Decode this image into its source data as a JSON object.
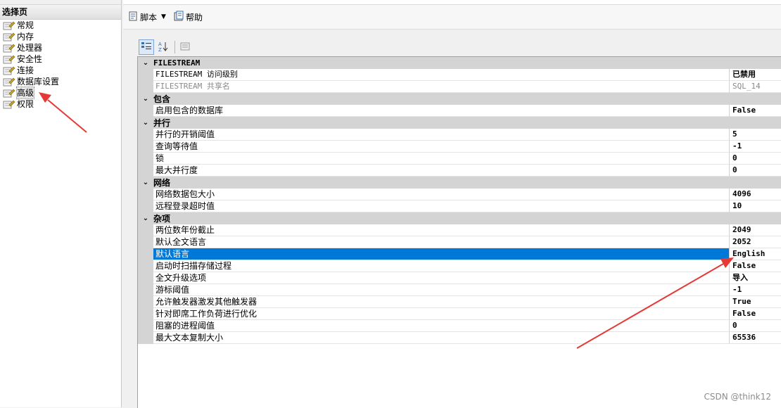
{
  "left_panel": {
    "header": "选择页",
    "items": [
      {
        "label": "常规"
      },
      {
        "label": "内存"
      },
      {
        "label": "处理器"
      },
      {
        "label": "安全性"
      },
      {
        "label": "连接"
      },
      {
        "label": "数据库设置"
      },
      {
        "label": "高级"
      },
      {
        "label": "权限"
      }
    ],
    "selected": "高级"
  },
  "toolbar": {
    "script_label": "脚本",
    "help_label": "帮助"
  },
  "grid": {
    "categories": [
      {
        "title": "FILESTREAM",
        "rows": [
          {
            "name": "FILESTREAM 访问级别",
            "value": "已禁用",
            "state": "normal"
          },
          {
            "name": "FILESTREAM 共享名",
            "value": "SQL_14",
            "state": "disabled"
          }
        ]
      },
      {
        "title": "包含",
        "rows": [
          {
            "name": "启用包含的数据库",
            "value": "False",
            "state": "normal"
          }
        ]
      },
      {
        "title": "并行",
        "rows": [
          {
            "name": "并行的开销阈值",
            "value": "5",
            "state": "normal"
          },
          {
            "name": "查询等待值",
            "value": "-1",
            "state": "normal"
          },
          {
            "name": "锁",
            "value": "0",
            "state": "normal"
          },
          {
            "name": "最大并行度",
            "value": "0",
            "state": "normal"
          }
        ]
      },
      {
        "title": "网络",
        "rows": [
          {
            "name": "网络数据包大小",
            "value": "4096",
            "state": "normal"
          },
          {
            "name": "远程登录超时值",
            "value": "10",
            "state": "normal"
          }
        ]
      },
      {
        "title": "杂项",
        "rows": [
          {
            "name": "两位数年份截止",
            "value": "2049",
            "state": "normal"
          },
          {
            "name": "默认全文语言",
            "value": "2052",
            "state": "normal"
          },
          {
            "name": "默认语言",
            "value": "English",
            "state": "highlighted"
          },
          {
            "name": "启动时扫描存储过程",
            "value": "False",
            "state": "normal"
          },
          {
            "name": "全文升级选项",
            "value": "导入",
            "state": "normal"
          },
          {
            "name": "游标阈值",
            "value": "-1",
            "state": "normal"
          },
          {
            "name": "允许触发器激发其他触发器",
            "value": "True",
            "state": "normal"
          },
          {
            "name": "针对即席工作负荷进行优化",
            "value": "False",
            "state": "normal"
          },
          {
            "name": "阻塞的进程阈值",
            "value": "0",
            "state": "normal"
          },
          {
            "name": "最大文本复制大小",
            "value": "65536",
            "state": "normal"
          }
        ]
      }
    ]
  },
  "colors": {
    "selection": "#0078d7",
    "category_bg": "#d4d4d4",
    "annotation_arrow": "#e53935"
  },
  "watermark": "CSDN @think12"
}
